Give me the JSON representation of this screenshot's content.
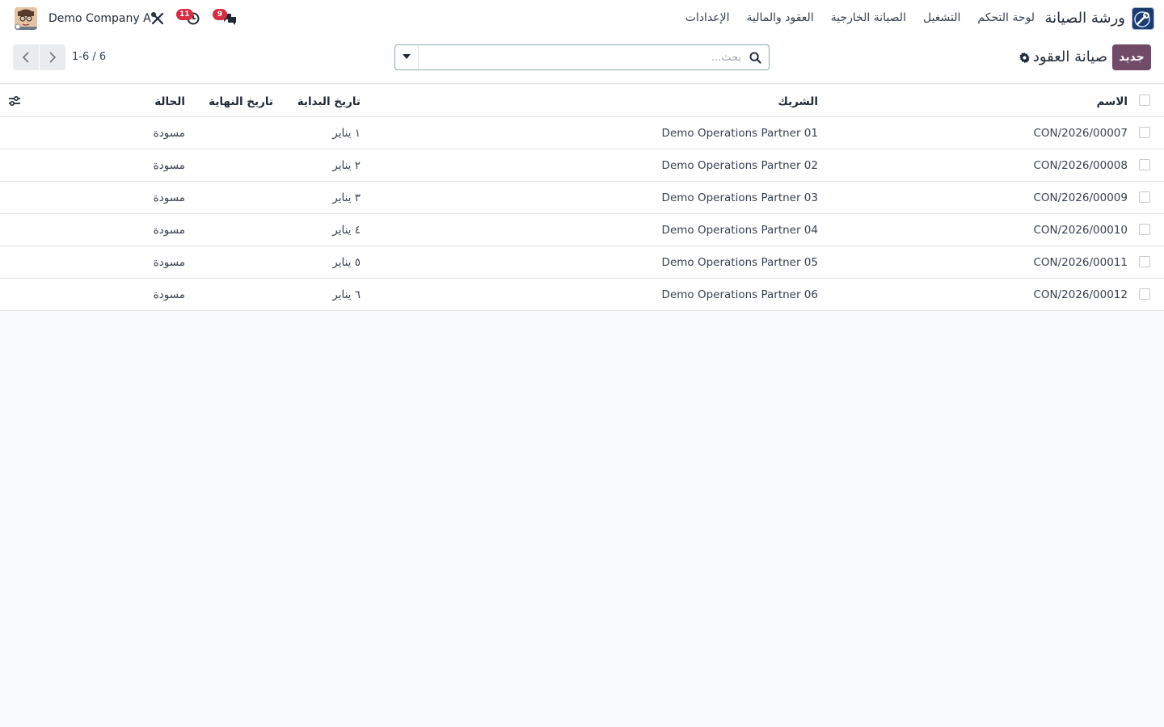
{
  "navbar": {
    "app_name": "ورشة الصيانة",
    "menu": [
      "لوحة التحكم",
      "التشغيل",
      "الصيانة الخارجية",
      "العقود والمالية",
      "الإعدادات"
    ],
    "company": "Demo Company A",
    "activity_count": "11",
    "message_count": "9"
  },
  "control": {
    "new_label": "جديد",
    "title": "صيانة العقود",
    "search_placeholder": "بحث...",
    "pager_value": "1-6 / 6"
  },
  "table": {
    "columns": [
      "الاسم",
      "الشريك",
      "تاريخ البداية",
      "تاريخ النهاية",
      "الحالة"
    ],
    "rows": [
      {
        "name": "CON/2026/00007",
        "partner": "Demo Operations Partner 01",
        "start": "١ يناير",
        "end": "",
        "state": "مسودة"
      },
      {
        "name": "CON/2026/00008",
        "partner": "Demo Operations Partner 02",
        "start": "٢ يناير",
        "end": "",
        "state": "مسودة"
      },
      {
        "name": "CON/2026/00009",
        "partner": "Demo Operations Partner 03",
        "start": "٣ يناير",
        "end": "",
        "state": "مسودة"
      },
      {
        "name": "CON/2026/00010",
        "partner": "Demo Operations Partner 04",
        "start": "٤ يناير",
        "end": "",
        "state": "مسودة"
      },
      {
        "name": "CON/2026/00011",
        "partner": "Demo Operations Partner 05",
        "start": "٥ يناير",
        "end": "",
        "state": "مسودة"
      },
      {
        "name": "CON/2026/00012",
        "partner": "Demo Operations Partner 06",
        "start": "٦ يناير",
        "end": "",
        "state": "مسودة"
      }
    ]
  },
  "colors": {
    "primary": "#714b67",
    "badge": "#d62d3f",
    "app_logo": "#1c3c6e"
  },
  "icons": {
    "app": "wrench-logo-icon",
    "tools": "tools-icon",
    "activity": "clock-icon",
    "messages": "chat-icon",
    "settings": "gear-icon",
    "search": "search-icon",
    "filter_toggle": "caret-down-icon",
    "optional_columns": "sliders-icon"
  }
}
